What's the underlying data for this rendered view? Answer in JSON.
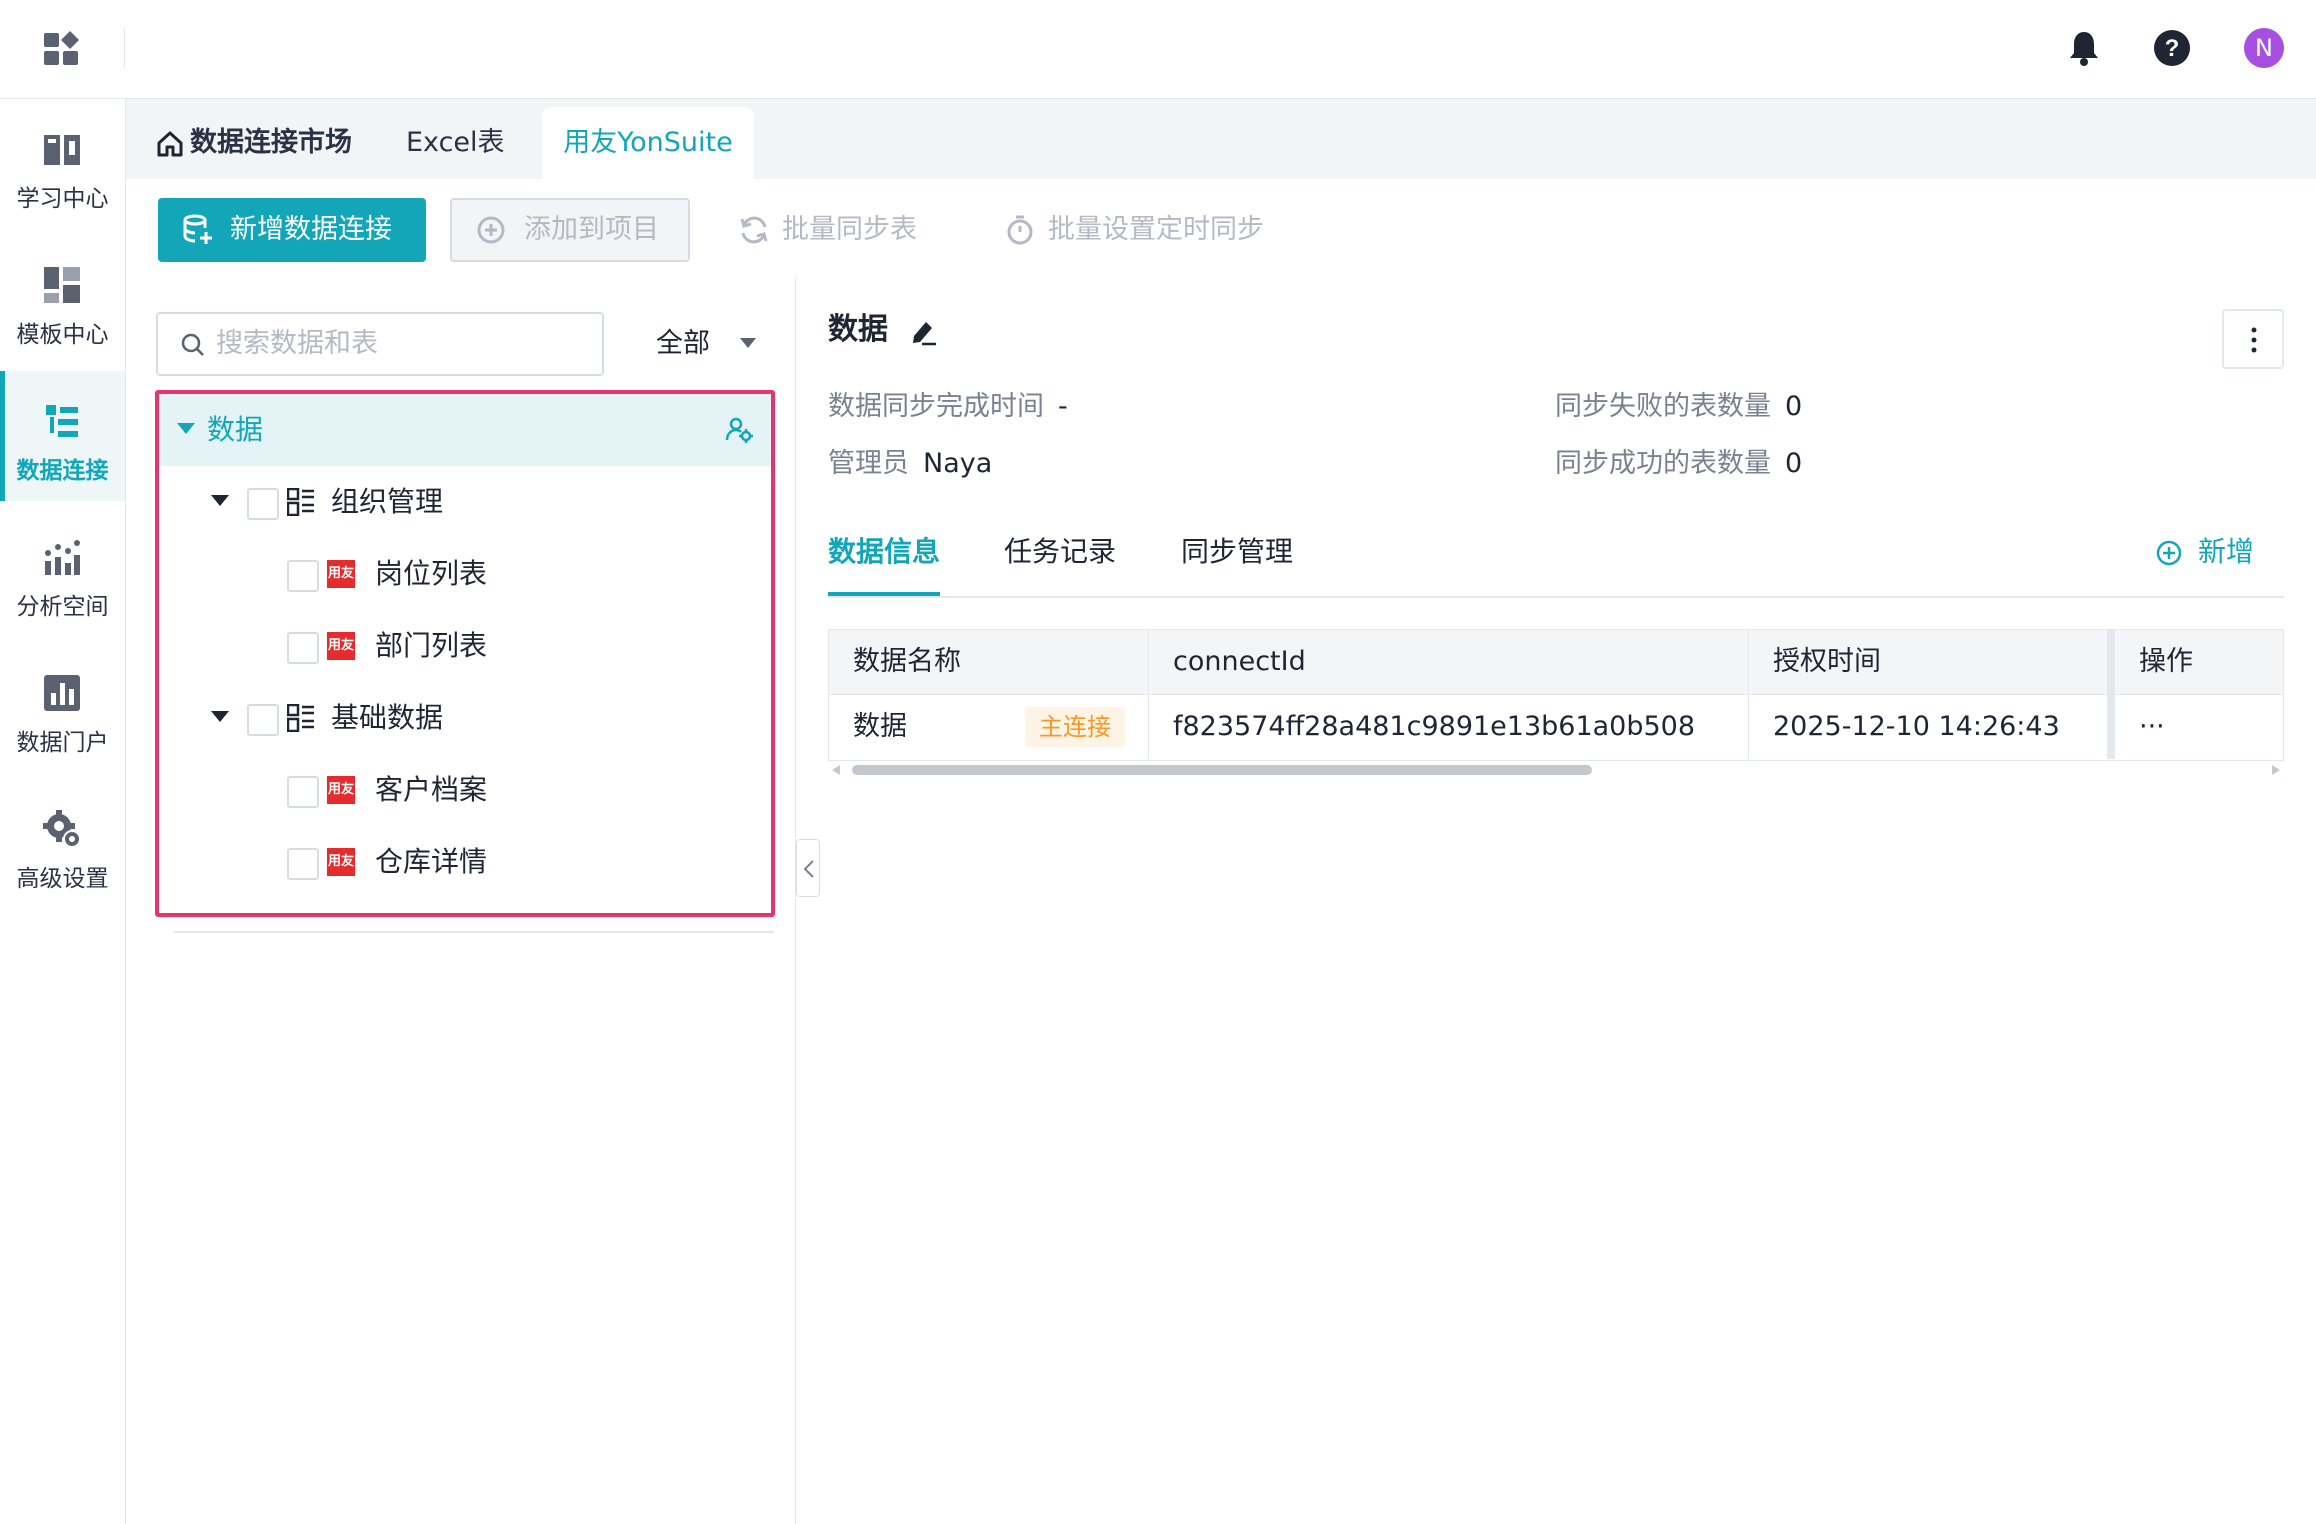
{
  "topbar": {
    "user_initial": "N"
  },
  "leftnav": {
    "items": [
      {
        "label": "学习中心",
        "icon": "book-icon"
      },
      {
        "label": "模板中心",
        "icon": "template-icon"
      },
      {
        "label": "数据连接",
        "icon": "data-connect-icon",
        "active": true
      },
      {
        "label": "分析空间",
        "icon": "analysis-icon"
      },
      {
        "label": "数据门户",
        "icon": "portal-icon"
      },
      {
        "label": "高级设置",
        "icon": "gear-icon"
      }
    ]
  },
  "tabs": {
    "home": "数据连接市场",
    "excel": "Excel表",
    "yonsuite": "用友YonSuite"
  },
  "toolbar": {
    "new_connection": "新增数据连接",
    "add_to_project": "添加到项目",
    "batch_sync": "批量同步表",
    "batch_schedule": "批量设置定时同步"
  },
  "leftpanel": {
    "search_placeholder": "搜索数据和表",
    "filter_value": "全部",
    "tree": {
      "root": "数据",
      "groups": [
        {
          "label": "组织管理",
          "items": [
            "岗位列表",
            "部门列表"
          ]
        },
        {
          "label": "基础数据",
          "items": [
            "客户档案",
            "仓库详情"
          ]
        }
      ],
      "item_icon_text": "用友"
    }
  },
  "detail": {
    "title": "数据",
    "sync_time_label": "数据同步完成时间",
    "sync_time_value": "-",
    "admin_label": "管理员",
    "admin_value": "Naya",
    "failed_label": "同步失败的表数量",
    "failed_value": "0",
    "success_label": "同步成功的表数量",
    "success_value": "0",
    "tabs": [
      "数据信息",
      "任务记录",
      "同步管理"
    ],
    "add_label": "新增"
  },
  "table": {
    "headers": [
      "数据名称",
      "connectId",
      "授权时间",
      "操作"
    ],
    "rows": [
      {
        "name": "数据",
        "badge": "主连接",
        "connectId": "f823574ff28a481c9891e13b61a0b508",
        "auth_time": "2025-12-10 14:26:43",
        "action": "···"
      }
    ]
  },
  "colors": {
    "accent": "#12a6b8",
    "highlight_border": "#e6346e",
    "badge_text": "#f39a26",
    "avatar": "#a64fe0",
    "yonyou_red": "#e52b2b"
  }
}
